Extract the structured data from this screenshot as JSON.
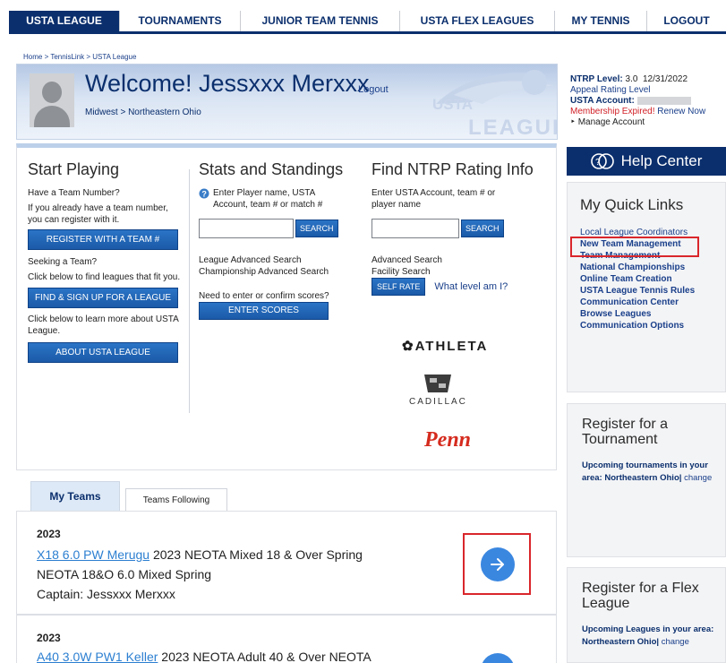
{
  "nav": {
    "items": [
      "USTA LEAGUE",
      "TOURNAMENTS",
      "JUNIOR TEAM TENNIS",
      "USTA FLEX LEAGUES",
      "MY TENNIS",
      "LOGOUT"
    ]
  },
  "breadcrumb": "Home > TennisLink > USTA League",
  "welcome": {
    "title": "Welcome! Jessxxx Merxxx",
    "logout": "Logout",
    "region": "Midwest > Northeastern Ohio"
  },
  "logo": {
    "top": "USTA",
    "bottom": "LEAGUE"
  },
  "account": {
    "ntrp_label": "NTRP Level:",
    "ntrp_value": "3.0",
    "ntrp_date": "12/31/2022",
    "appeal": "Appeal Rating Level",
    "usta_account_label": "USTA Account:",
    "membership_expired": "Membership Expired!",
    "renew": "Renew Now",
    "manage": "Manage Account"
  },
  "help_center": "Help Center",
  "start_playing": {
    "title": "Start Playing",
    "have_team": "Have a Team Number?",
    "have_team_desc": "If you already have a team number, you can register with it.",
    "register_button": "REGISTER WITH A TEAM #",
    "seeking": "Seeking a Team?",
    "seeking_desc": "Click below to find leagues that fit you.",
    "find_button": "FIND & SIGN UP FOR A LEAGUE",
    "learn_desc": "Click below to learn more about USTA League.",
    "about_button": "ABOUT USTA LEAGUE"
  },
  "stats": {
    "title": "Stats and Standings",
    "instruction": "Enter Player name, USTA Account, team # or match #",
    "search_button": "SEARCH",
    "league_advanced": "League Advanced Search",
    "championship_advanced": "Championship Advanced Search",
    "scores_prompt": "Need to enter or confirm scores?",
    "enter_scores_button": "ENTER SCORES"
  },
  "ntrp": {
    "title": "Find NTRP Rating Info",
    "instruction": "Enter USTA Account, team # or player name",
    "search_button": "SEARCH",
    "advanced": "Advanced Search",
    "facility": "Facility Search",
    "self_rate_button": "SELF RATE",
    "what_level": "What level am I?"
  },
  "sponsors": {
    "athleta": "ATHLETA",
    "cadillac": "CADILLAC",
    "penn": "Penn"
  },
  "quick_links": {
    "title": "My Quick Links",
    "items": [
      "Local League Coordinators",
      "New Team Management",
      "Team Management",
      "National Championships",
      "Online Team Creation",
      "USTA League Tennis Rules",
      "Communication Center",
      "Browse Leagues",
      "Communication Options"
    ]
  },
  "tournament": {
    "title": "Register for a Tournament",
    "desc": "Upcoming tournaments in your area: Northeastern Ohio|",
    "change": "change"
  },
  "flex": {
    "title": "Register for a Flex League",
    "desc": "Upcoming Leagues in your area: Northeastern Ohio|",
    "change": "change"
  },
  "tabs": {
    "my_teams": "My Teams",
    "following": "Teams Following"
  },
  "teams": [
    {
      "year": "2023",
      "team_link": "X18 6.0 PW Merugu",
      "league_line1": " 2023 NEOTA Mixed 18 & Over Spring",
      "league_line2": "NEOTA 18&O 6.0 Mixed Spring",
      "captain": "Captain: Jessxxx Merxxx"
    },
    {
      "year": "2023",
      "team_link": "A40 3.0W PW1 Keller",
      "league_line1": " 2023 NEOTA Adult 40 & Over NEOTA"
    }
  ]
}
